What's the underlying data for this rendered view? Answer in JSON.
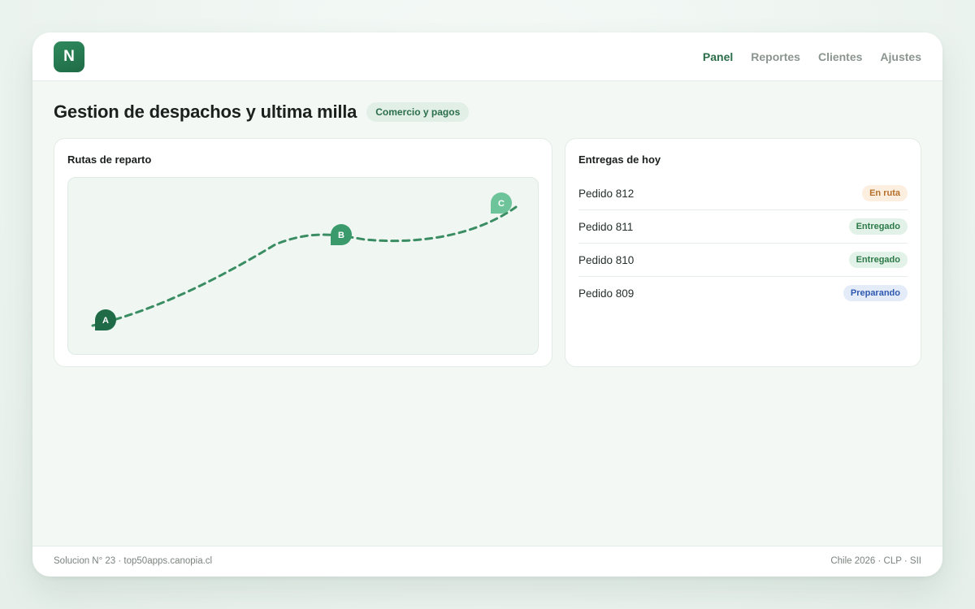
{
  "header": {
    "logo_letter": "N",
    "nav": [
      {
        "label": "Panel",
        "active": true
      },
      {
        "label": "Reportes",
        "active": false
      },
      {
        "label": "Clientes",
        "active": false
      },
      {
        "label": "Ajustes",
        "active": false
      }
    ]
  },
  "page": {
    "title": "Gestion de despachos y ultima milla",
    "category_badge": "Comercio y pagos"
  },
  "routes_card": {
    "title": "Rutas de reparto",
    "stops": [
      {
        "label": "A",
        "color": "#1f6b47"
      },
      {
        "label": "B",
        "color": "#3a9a6c"
      },
      {
        "label": "C",
        "color": "#6ec49a"
      }
    ],
    "route_color": "#3a8d63"
  },
  "deliveries_card": {
    "title": "Entregas de hoy",
    "orders": [
      {
        "name": "Pedido 812",
        "status": "En ruta",
        "status_kind": "route"
      },
      {
        "name": "Pedido 811",
        "status": "Entregado",
        "status_kind": "done"
      },
      {
        "name": "Pedido 810",
        "status": "Entregado",
        "status_kind": "done"
      },
      {
        "name": "Pedido 809",
        "status": "Preparando",
        "status_kind": "prep"
      }
    ]
  },
  "footer": {
    "left": "Solucion N° 23 · top50apps.canopia.cl",
    "right": "Chile 2026 · CLP · SII"
  },
  "colors": {
    "brand": "#2b6e4a",
    "status_route": "#b6702c",
    "status_done": "#2b7a47",
    "status_prep": "#2e59b0"
  }
}
